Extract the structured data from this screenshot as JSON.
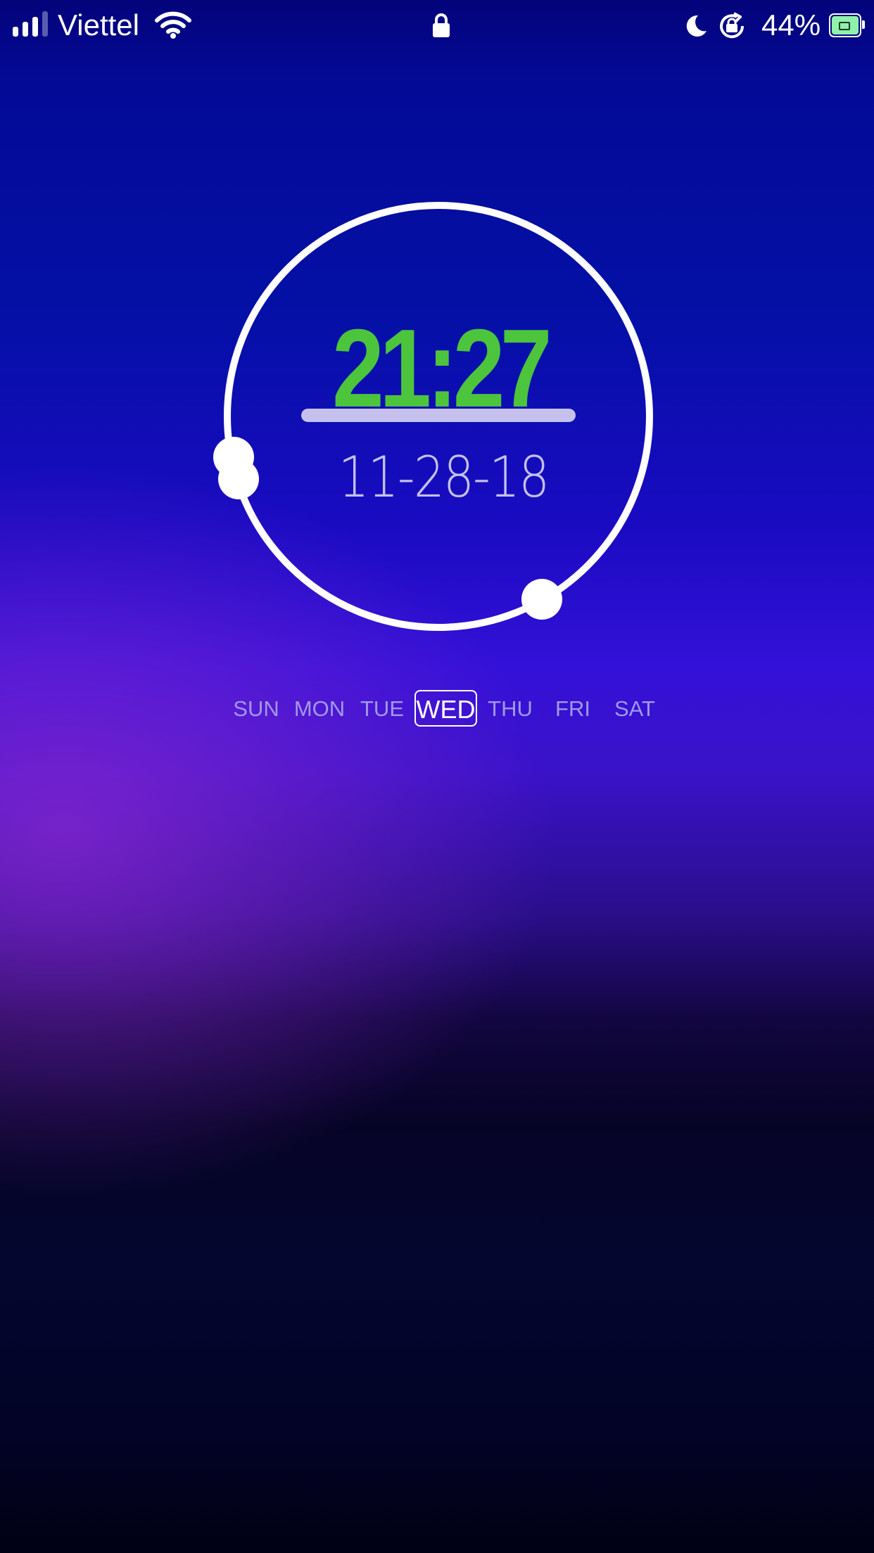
{
  "status_bar": {
    "carrier": "Viettel",
    "battery_percent": "44%",
    "signal_bars_filled": 3,
    "signal_bars_total": 4,
    "icons": [
      "signal-icon",
      "wifi-icon",
      "lock-icon",
      "moon-icon",
      "rotation-lock-icon",
      "battery-icon"
    ]
  },
  "clock": {
    "time": "21:27",
    "date": "11-28-18"
  },
  "weekdays": {
    "days": [
      "SUN",
      "MON",
      "TUE",
      "WED",
      "THU",
      "FRI",
      "SAT"
    ],
    "selected": "WED"
  },
  "colors": {
    "time": "#4cc53c",
    "divider": "#c6c1ec",
    "date": "#c4c0ee",
    "weekday_inactive": "#a198ea",
    "weekday_active": "#ffffff",
    "battery_fill": "#8ff2ab",
    "background_top": "#03037a",
    "background_mid": "#3411d8",
    "background_bottom": "#010114"
  }
}
